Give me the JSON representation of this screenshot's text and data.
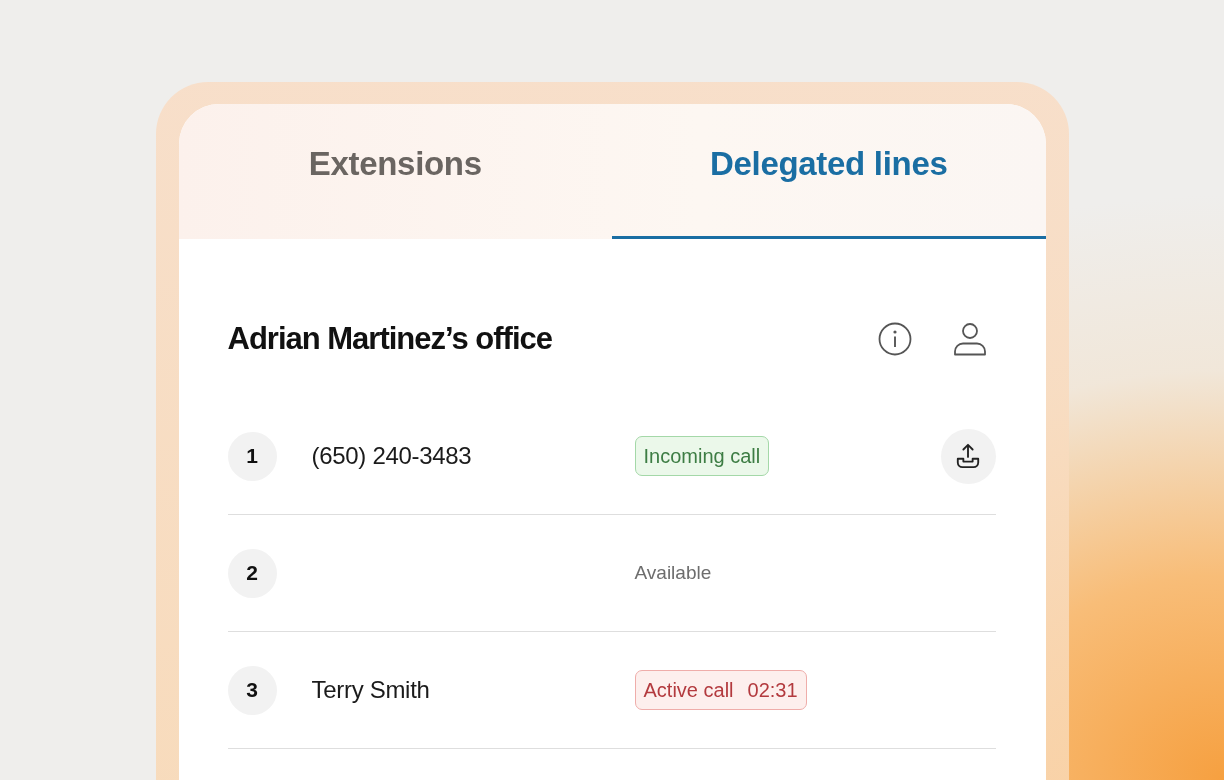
{
  "tabs": [
    {
      "label": "Extensions",
      "selected": false
    },
    {
      "label": "Delegated lines",
      "selected": true
    }
  ],
  "office": {
    "title": "Adrian Martinez’s office"
  },
  "lines": [
    {
      "number": "1",
      "caller": "(650) 240-3483",
      "status": {
        "kind": "incoming",
        "label": "Incoming call"
      },
      "action_button": true
    },
    {
      "number": "2",
      "status": {
        "kind": "available",
        "label": "Available"
      },
      "action_button": false
    },
    {
      "number": "3",
      "caller": "Terry Smith",
      "status": {
        "kind": "active",
        "label": "Active call",
        "timer": "02:31"
      },
      "action_button": false
    }
  ]
}
